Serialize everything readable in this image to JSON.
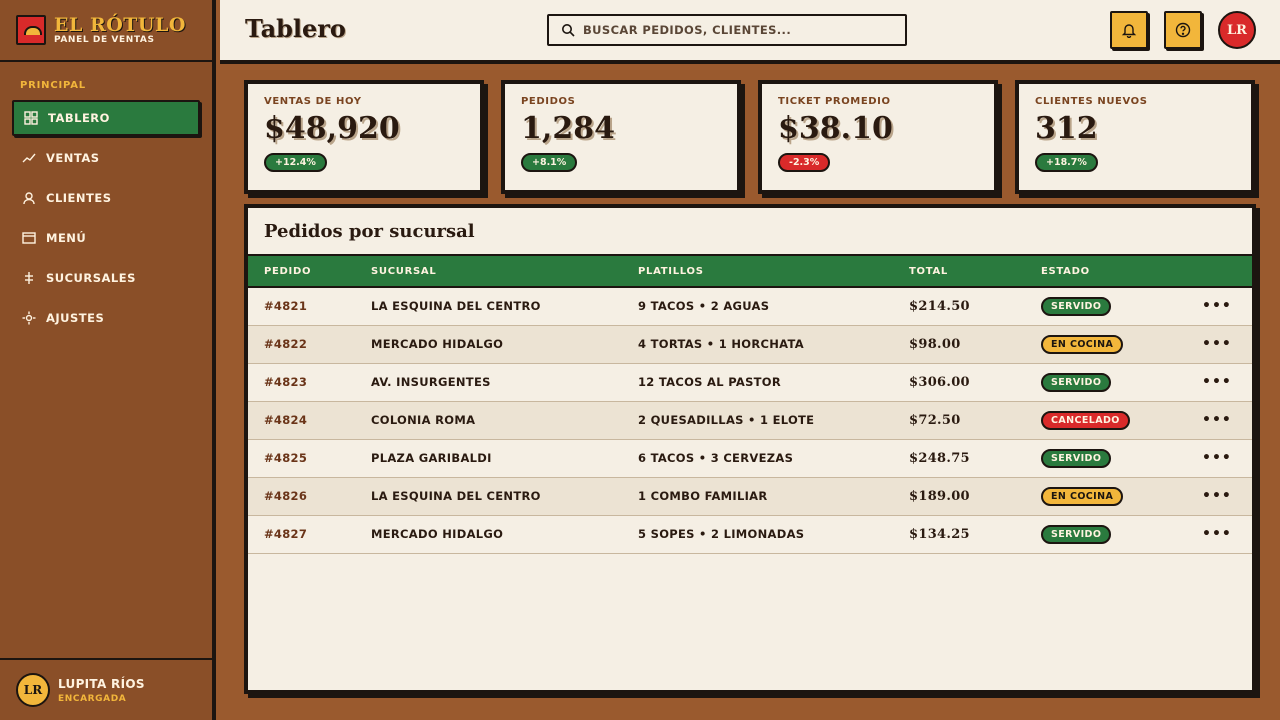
{
  "brand": {
    "name": "EL RÓTULO",
    "subtitle": "PANEL DE VENTAS"
  },
  "sidebar": {
    "section": "PRINCIPAL",
    "items": [
      {
        "label": "TABLERO",
        "icon": "grid-icon",
        "active": true
      },
      {
        "label": "VENTAS",
        "icon": "trend-icon"
      },
      {
        "label": "CLIENTES",
        "icon": "user-icon"
      },
      {
        "label": "MENÚ",
        "icon": "menu-card-icon"
      },
      {
        "label": "SUCURSALES",
        "icon": "signpost-icon"
      },
      {
        "label": "AJUSTES",
        "icon": "sun-gear-icon"
      }
    ],
    "user": {
      "initials": "LR",
      "name": "LUPITA RÍOS",
      "role": "ENCARGADA"
    }
  },
  "header": {
    "title": "Tablero",
    "search_placeholder": "BUSCAR PEDIDOS, CLIENTES...",
    "avatar_initials": "LR"
  },
  "kpis": [
    {
      "label": "VENTAS DE HOY",
      "value": "$48,920",
      "delta": "+12.4%",
      "trend": "up"
    },
    {
      "label": "PEDIDOS",
      "value": "1,284",
      "delta": "+8.1%",
      "trend": "up"
    },
    {
      "label": "TICKET PROMEDIO",
      "value": "$38.10",
      "delta": "-2.3%",
      "trend": "down"
    },
    {
      "label": "CLIENTES NUEVOS",
      "value": "312",
      "delta": "+18.7%",
      "trend": "up"
    }
  ],
  "orders": {
    "title": "Pedidos por sucursal",
    "columns": [
      "PEDIDO",
      "SUCURSAL",
      "PLATILLOS",
      "TOTAL",
      "ESTADO"
    ],
    "rows": [
      {
        "id": "#4821",
        "branch": "LA ESQUINA DEL CENTRO",
        "items": "9 TACOS • 2 AGUAS",
        "total": "$214.50",
        "status": "SERVIDO",
        "status_type": "servido"
      },
      {
        "id": "#4822",
        "branch": "MERCADO HIDALGO",
        "items": "4 TORTAS • 1 HORCHATA",
        "total": "$98.00",
        "status": "EN COCINA",
        "status_type": "cocina"
      },
      {
        "id": "#4823",
        "branch": "AV. INSURGENTES",
        "items": "12 TACOS AL PASTOR",
        "total": "$306.00",
        "status": "SERVIDO",
        "status_type": "servido"
      },
      {
        "id": "#4824",
        "branch": "COLONIA ROMA",
        "items": "2 QUESADILLAS • 1 ELOTE",
        "total": "$72.50",
        "status": "CANCELADO",
        "status_type": "cancelado"
      },
      {
        "id": "#4825",
        "branch": "PLAZA GARIBALDI",
        "items": "6 TACOS • 3 CERVEZAS",
        "total": "$248.75",
        "status": "SERVIDO",
        "status_type": "servido"
      },
      {
        "id": "#4826",
        "branch": "LA ESQUINA DEL CENTRO",
        "items": "1 COMBO FAMILIAR",
        "total": "$189.00",
        "status": "EN COCINA",
        "status_type": "cocina"
      },
      {
        "id": "#4827",
        "branch": "MERCADO HIDALGO",
        "items": "5 SOPES • 2 LIMONADAS",
        "total": "$134.25",
        "status": "SERVIDO",
        "status_type": "servido"
      }
    ]
  },
  "colors": {
    "background": "#9a5a2e",
    "sidebar": "#8a4f28",
    "paper": "#f5efe4",
    "green": "#2a7a3e",
    "red": "#d92a2a",
    "mustard": "#f2b63b",
    "ink": "#1c1510"
  }
}
